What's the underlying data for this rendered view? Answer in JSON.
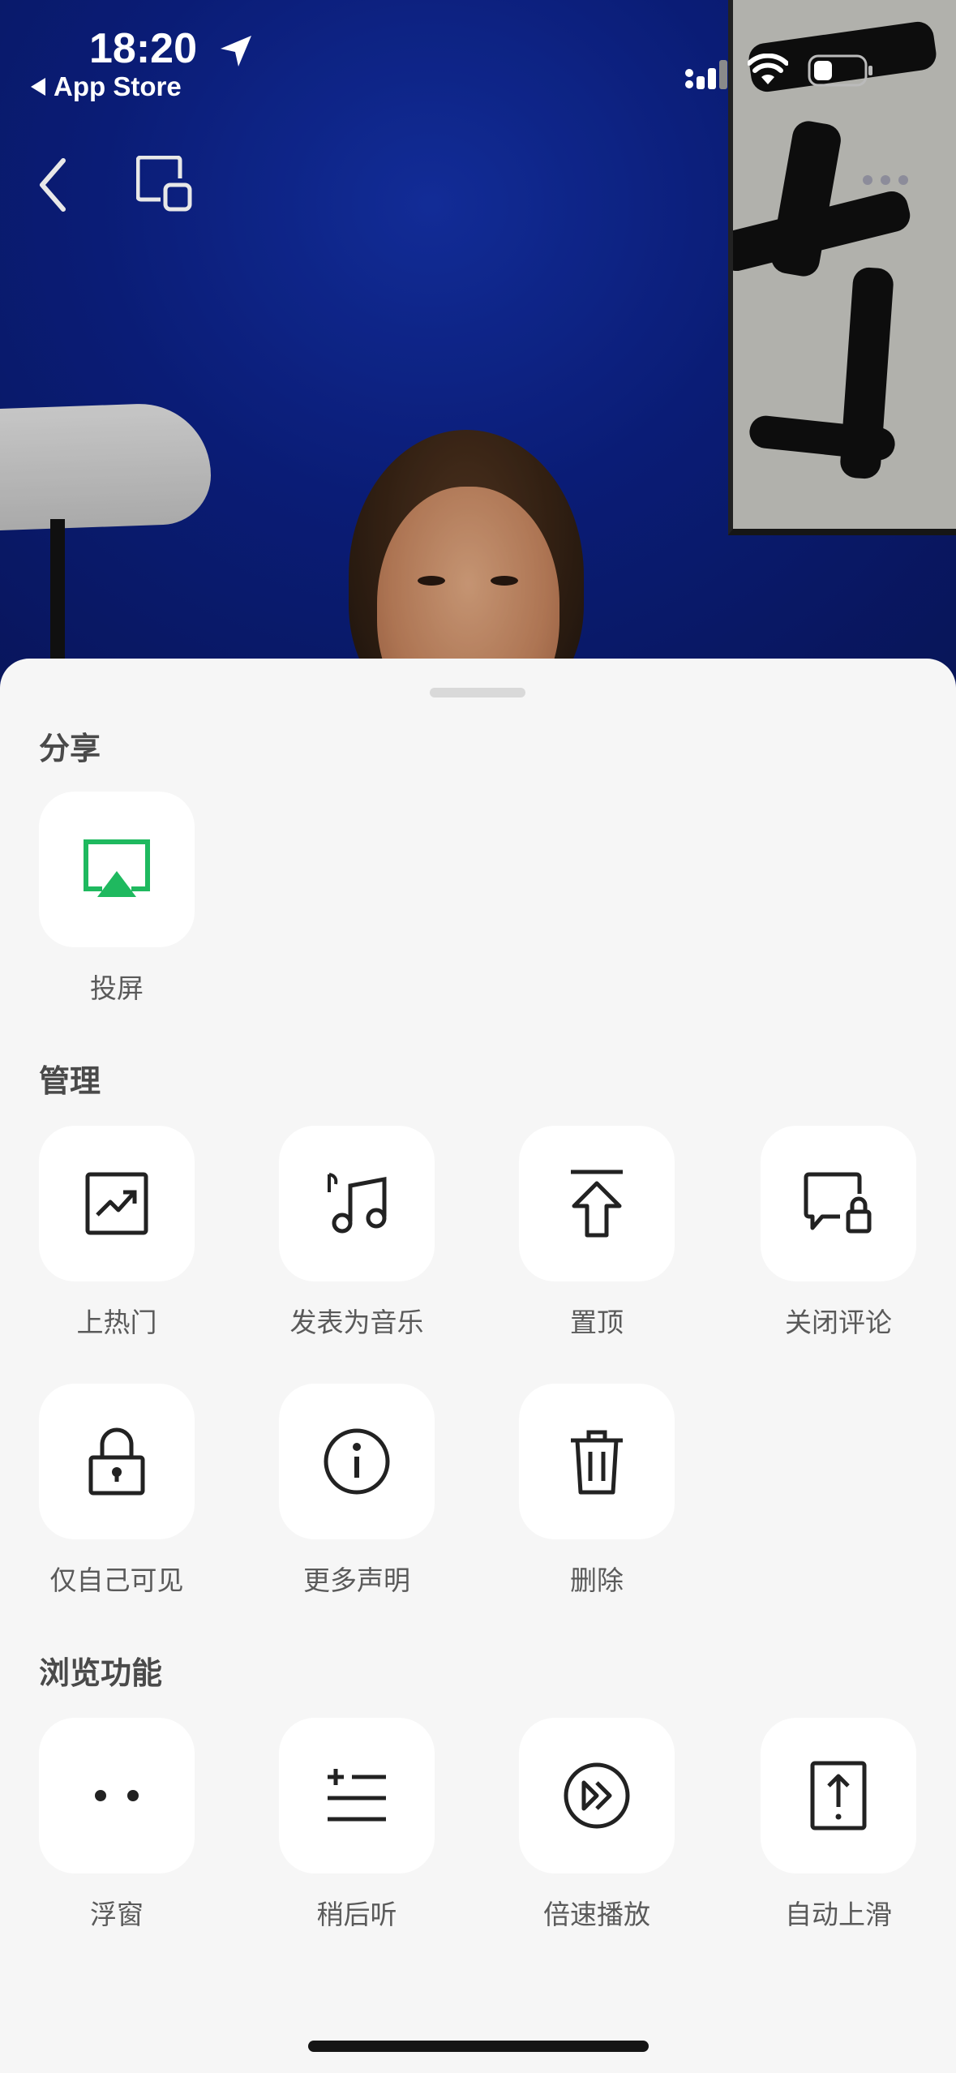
{
  "status_bar": {
    "time": "18:20",
    "back_app_label": "App Store"
  },
  "sections": {
    "share": {
      "title": "分享",
      "items": [
        {
          "label": "投屏",
          "icon": "airplay-icon",
          "color": "#1fb95f"
        }
      ]
    },
    "manage": {
      "title": "管理",
      "items": [
        {
          "label": "上热门",
          "icon": "trending-icon"
        },
        {
          "label": "发表为音乐",
          "icon": "music-note-icon"
        },
        {
          "label": "置顶",
          "icon": "pin-top-icon"
        },
        {
          "label": "关闭评论",
          "icon": "comment-lock-icon"
        },
        {
          "label": "仅自己可见",
          "icon": "lock-icon"
        },
        {
          "label": "更多声明",
          "icon": "info-icon"
        },
        {
          "label": "删除",
          "icon": "trash-icon"
        }
      ]
    },
    "browse": {
      "title": "浏览功能",
      "items": [
        {
          "label": "浮窗",
          "icon": "float-window-icon"
        },
        {
          "label": "稍后听",
          "icon": "listen-later-icon"
        },
        {
          "label": "倍速播放",
          "icon": "speed-play-icon"
        },
        {
          "label": "自动上滑",
          "icon": "auto-scroll-up-icon"
        }
      ]
    }
  },
  "colors": {
    "sheet_bg": "#f6f6f6",
    "tile_bg": "#ffffff",
    "accent_green": "#1fb95f",
    "label_text": "#5a5a5a"
  }
}
